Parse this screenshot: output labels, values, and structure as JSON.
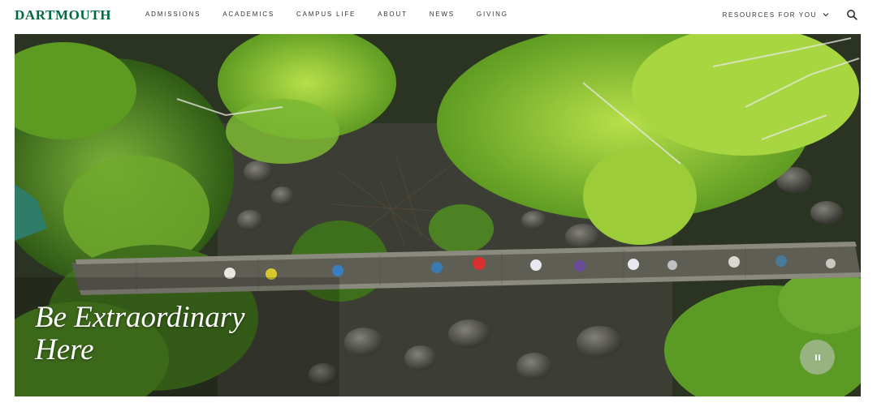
{
  "header": {
    "logo": "DARTMOUTH",
    "nav": [
      "ADMISSIONS",
      "ACADEMICS",
      "CAMPUS LIFE",
      "ABOUT",
      "NEWS",
      "GIVING"
    ],
    "resources_label": "RESOURCES FOR YOU",
    "icons": {
      "resources": "chevron-down-icon",
      "search": "search-icon"
    }
  },
  "hero": {
    "headline_line1": "Be Extraordinary",
    "headline_line2": "Here",
    "control_icon": "pause-icon"
  },
  "colors": {
    "brand": "#00693e",
    "nav_text": "#333333"
  }
}
